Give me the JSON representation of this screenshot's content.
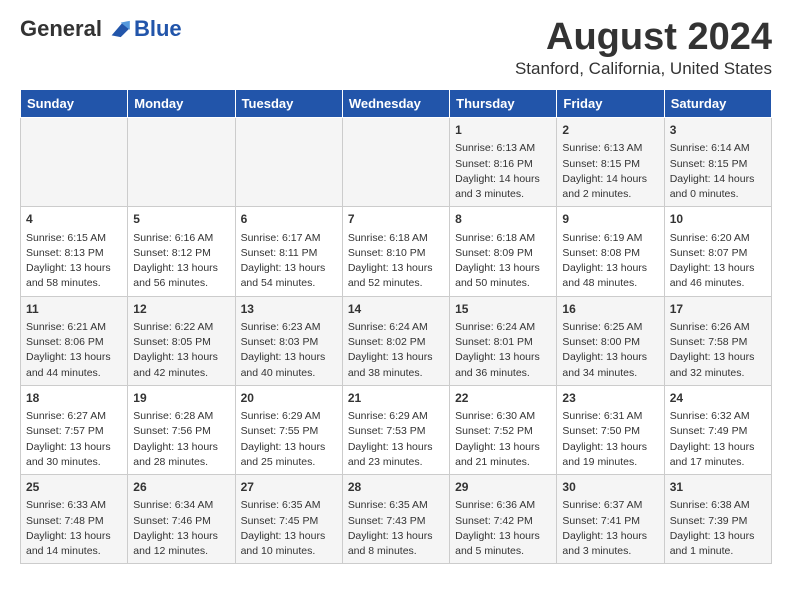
{
  "header": {
    "logo_general": "General",
    "logo_blue": "Blue",
    "main_title": "August 2024",
    "subtitle": "Stanford, California, United States"
  },
  "weekdays": [
    "Sunday",
    "Monday",
    "Tuesday",
    "Wednesday",
    "Thursday",
    "Friday",
    "Saturday"
  ],
  "weeks": [
    [
      {
        "day": "",
        "content": ""
      },
      {
        "day": "",
        "content": ""
      },
      {
        "day": "",
        "content": ""
      },
      {
        "day": "",
        "content": ""
      },
      {
        "day": "1",
        "content": "Sunrise: 6:13 AM\nSunset: 8:16 PM\nDaylight: 14 hours\nand 3 minutes."
      },
      {
        "day": "2",
        "content": "Sunrise: 6:13 AM\nSunset: 8:15 PM\nDaylight: 14 hours\nand 2 minutes."
      },
      {
        "day": "3",
        "content": "Sunrise: 6:14 AM\nSunset: 8:15 PM\nDaylight: 14 hours\nand 0 minutes."
      }
    ],
    [
      {
        "day": "4",
        "content": "Sunrise: 6:15 AM\nSunset: 8:13 PM\nDaylight: 13 hours\nand 58 minutes."
      },
      {
        "day": "5",
        "content": "Sunrise: 6:16 AM\nSunset: 8:12 PM\nDaylight: 13 hours\nand 56 minutes."
      },
      {
        "day": "6",
        "content": "Sunrise: 6:17 AM\nSunset: 8:11 PM\nDaylight: 13 hours\nand 54 minutes."
      },
      {
        "day": "7",
        "content": "Sunrise: 6:18 AM\nSunset: 8:10 PM\nDaylight: 13 hours\nand 52 minutes."
      },
      {
        "day": "8",
        "content": "Sunrise: 6:18 AM\nSunset: 8:09 PM\nDaylight: 13 hours\nand 50 minutes."
      },
      {
        "day": "9",
        "content": "Sunrise: 6:19 AM\nSunset: 8:08 PM\nDaylight: 13 hours\nand 48 minutes."
      },
      {
        "day": "10",
        "content": "Sunrise: 6:20 AM\nSunset: 8:07 PM\nDaylight: 13 hours\nand 46 minutes."
      }
    ],
    [
      {
        "day": "11",
        "content": "Sunrise: 6:21 AM\nSunset: 8:06 PM\nDaylight: 13 hours\nand 44 minutes."
      },
      {
        "day": "12",
        "content": "Sunrise: 6:22 AM\nSunset: 8:05 PM\nDaylight: 13 hours\nand 42 minutes."
      },
      {
        "day": "13",
        "content": "Sunrise: 6:23 AM\nSunset: 8:03 PM\nDaylight: 13 hours\nand 40 minutes."
      },
      {
        "day": "14",
        "content": "Sunrise: 6:24 AM\nSunset: 8:02 PM\nDaylight: 13 hours\nand 38 minutes."
      },
      {
        "day": "15",
        "content": "Sunrise: 6:24 AM\nSunset: 8:01 PM\nDaylight: 13 hours\nand 36 minutes."
      },
      {
        "day": "16",
        "content": "Sunrise: 6:25 AM\nSunset: 8:00 PM\nDaylight: 13 hours\nand 34 minutes."
      },
      {
        "day": "17",
        "content": "Sunrise: 6:26 AM\nSunset: 7:58 PM\nDaylight: 13 hours\nand 32 minutes."
      }
    ],
    [
      {
        "day": "18",
        "content": "Sunrise: 6:27 AM\nSunset: 7:57 PM\nDaylight: 13 hours\nand 30 minutes."
      },
      {
        "day": "19",
        "content": "Sunrise: 6:28 AM\nSunset: 7:56 PM\nDaylight: 13 hours\nand 28 minutes."
      },
      {
        "day": "20",
        "content": "Sunrise: 6:29 AM\nSunset: 7:55 PM\nDaylight: 13 hours\nand 25 minutes."
      },
      {
        "day": "21",
        "content": "Sunrise: 6:29 AM\nSunset: 7:53 PM\nDaylight: 13 hours\nand 23 minutes."
      },
      {
        "day": "22",
        "content": "Sunrise: 6:30 AM\nSunset: 7:52 PM\nDaylight: 13 hours\nand 21 minutes."
      },
      {
        "day": "23",
        "content": "Sunrise: 6:31 AM\nSunset: 7:50 PM\nDaylight: 13 hours\nand 19 minutes."
      },
      {
        "day": "24",
        "content": "Sunrise: 6:32 AM\nSunset: 7:49 PM\nDaylight: 13 hours\nand 17 minutes."
      }
    ],
    [
      {
        "day": "25",
        "content": "Sunrise: 6:33 AM\nSunset: 7:48 PM\nDaylight: 13 hours\nand 14 minutes."
      },
      {
        "day": "26",
        "content": "Sunrise: 6:34 AM\nSunset: 7:46 PM\nDaylight: 13 hours\nand 12 minutes."
      },
      {
        "day": "27",
        "content": "Sunrise: 6:35 AM\nSunset: 7:45 PM\nDaylight: 13 hours\nand 10 minutes."
      },
      {
        "day": "28",
        "content": "Sunrise: 6:35 AM\nSunset: 7:43 PM\nDaylight: 13 hours\nand 8 minutes."
      },
      {
        "day": "29",
        "content": "Sunrise: 6:36 AM\nSunset: 7:42 PM\nDaylight: 13 hours\nand 5 minutes."
      },
      {
        "day": "30",
        "content": "Sunrise: 6:37 AM\nSunset: 7:41 PM\nDaylight: 13 hours\nand 3 minutes."
      },
      {
        "day": "31",
        "content": "Sunrise: 6:38 AM\nSunset: 7:39 PM\nDaylight: 13 hours\nand 1 minute."
      }
    ]
  ]
}
